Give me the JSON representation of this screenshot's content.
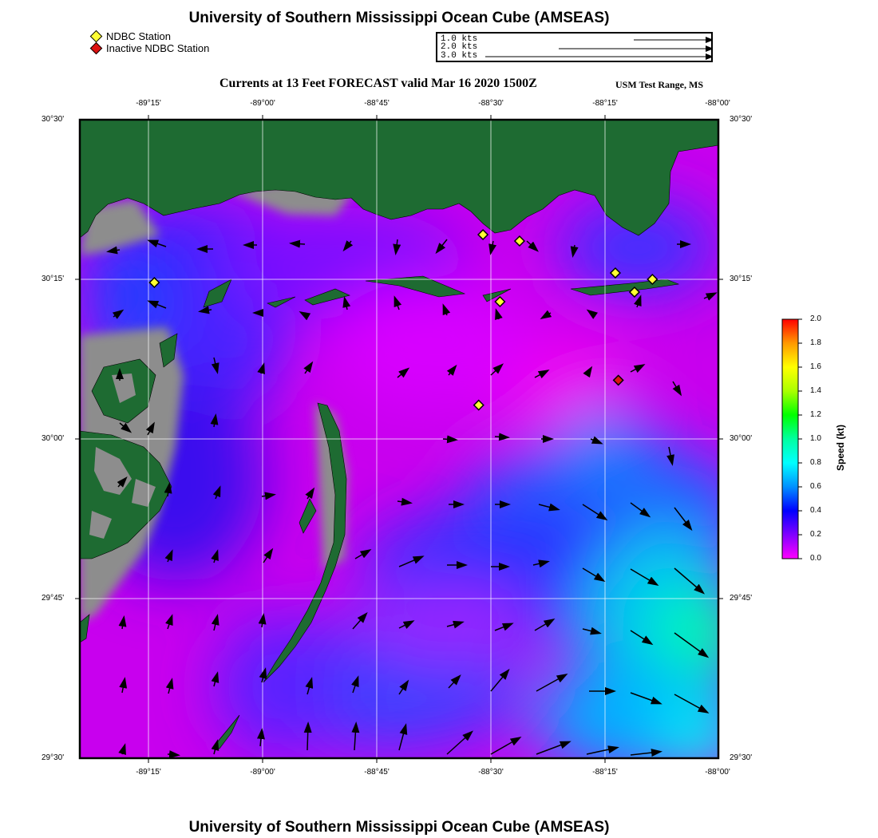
{
  "header": {
    "title": "University of Southern Mississippi Ocean Cube (AMSEAS)",
    "subtitle": "Currents at 13 Feet FORECAST valid Mar 16 2020 1500Z",
    "region": "USM Test Range, MS"
  },
  "footer": {
    "title": "University of Southern Mississippi Ocean Cube (AMSEAS)"
  },
  "legend": {
    "items": [
      {
        "label": "NDBC Station",
        "color": "#ffff33"
      },
      {
        "label": "Inactive NDBC Station",
        "color": "#dd1111"
      }
    ],
    "scale_labels": [
      "1.0 kts",
      "2.0 kts",
      "3.0 kts"
    ]
  },
  "map": {
    "lon_ticks": [
      "-89°15'",
      "-89°00'",
      "-88°45'",
      "-88°30'",
      "-88°15'",
      "-88°00'"
    ],
    "lat_ticks": [
      "30°30'",
      "30°15'",
      "30°00'",
      "29°45'",
      "29°30'"
    ],
    "land_color": "#1e6b32",
    "shallow_color": "#8a8a8a",
    "stations": [
      {
        "lon": -89.325,
        "lat": 30.245,
        "status": "active"
      },
      {
        "lon": -88.553,
        "lat": 30.32,
        "status": "active"
      },
      {
        "lon": -88.467,
        "lat": 30.31,
        "status": "active"
      },
      {
        "lon": -88.242,
        "lat": 30.26,
        "status": "active"
      },
      {
        "lon": -88.197,
        "lat": 30.23,
        "status": "active"
      },
      {
        "lon": -88.155,
        "lat": 30.25,
        "status": "active"
      },
      {
        "lon": -88.513,
        "lat": 30.215,
        "status": "active"
      },
      {
        "lon": -88.563,
        "lat": 30.053,
        "status": "active"
      },
      {
        "lon": -88.235,
        "lat": 30.092,
        "status": "inactive"
      }
    ]
  },
  "colorbar": {
    "label": "Speed (kt)",
    "ticks": [
      "2.0",
      "1.8",
      "1.6",
      "1.4",
      "1.2",
      "1.0",
      "0.8",
      "0.6",
      "0.4",
      "0.2",
      "0.0"
    ],
    "colors": [
      "#ff1010",
      "#ff8800",
      "#ffff00",
      "#00ff00",
      "#00ffee",
      "#00aaff",
      "#0000ff",
      "#ff00ff"
    ]
  }
}
